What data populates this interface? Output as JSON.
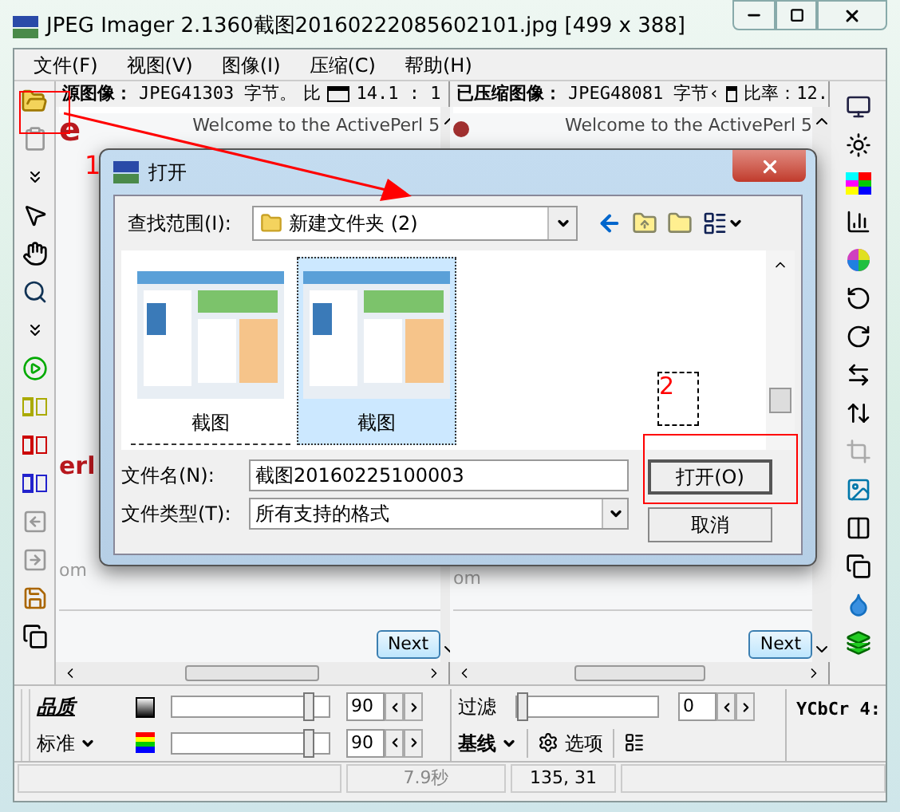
{
  "window": {
    "title": "JPEG Imager 2.1360截图20160222085602101.jpg [499 x 388]"
  },
  "menu": [
    {
      "label": "文件(F)"
    },
    {
      "label": "视图(V)"
    },
    {
      "label": "图像(I)"
    },
    {
      "label": "压缩(C)"
    },
    {
      "label": "帮助(H)"
    }
  ],
  "panes": [
    {
      "header": [
        {
          "kind": "title",
          "text": "源图像："
        },
        {
          "kind": "text",
          "text": "JPEG41303 字节。"
        },
        {
          "kind": "text",
          "text": "比"
        },
        {
          "kind": "window_icon"
        },
        {
          "kind": "text",
          "text": "14.1 : 1"
        }
      ],
      "logo_top": "e",
      "logo_mid": "erl",
      "welcome": "Welcome to the ActivePerl 5",
      "footer": "om",
      "next": "Next"
    },
    {
      "header": [
        {
          "kind": "title",
          "text": "已压缩图像："
        },
        {
          "kind": "text",
          "text": "JPEG48081 字节‹"
        },
        {
          "kind": "window_icon"
        },
        {
          "kind": "text",
          "text": "比率：12."
        }
      ],
      "welcome": "Welcome to the ActivePerl 5",
      "footer": "om",
      "next": "Next"
    }
  ],
  "dialog": {
    "title": "打开",
    "look_in_label": "查找范围(I):",
    "look_in_value": "新建文件夹 (2)",
    "files": [
      {
        "name": "截图",
        "selected": false
      },
      {
        "name": "截图",
        "selected": true
      }
    ],
    "filename_label": "文件名(N):",
    "filename": "截图20160225100003",
    "type_label": "文件类型(T):",
    "type_value": "所有支持的格式",
    "open_button": "打开(O)",
    "cancel_button": "取消"
  },
  "annotations": {
    "first": "1",
    "second": "2"
  },
  "quality": {
    "label": "品质",
    "preset": "标准",
    "sliders": [
      {
        "level": 0.9,
        "value": "90"
      },
      {
        "level": 0.9,
        "value": "90"
      }
    ]
  },
  "filter": {
    "label": "过滤",
    "level": 0,
    "value": "0"
  },
  "mode": "基线",
  "options": "选项",
  "subsampling": "YCbCr 4:",
  "status": [
    "7.9秒",
    "135, 31"
  ]
}
